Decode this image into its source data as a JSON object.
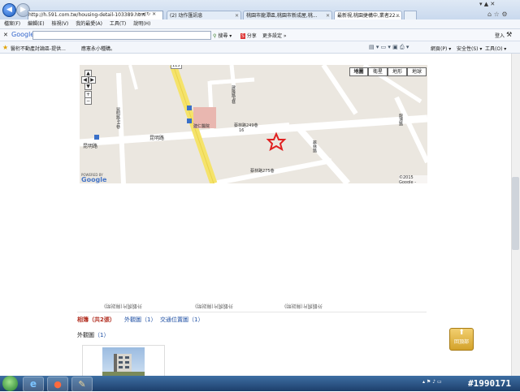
{
  "browser": {
    "address": "http://h.591.com.tw/housing-detail-103389.html",
    "tabs": [
      {
        "label": "(2) 动作匯訊息"
      },
      {
        "label": "桃園市龍潭區,桃園市新成屋,桃..."
      },
      {
        "label": "最新視,桃園捷構中,業者22...",
        "active": true
      }
    ],
    "window_caption": "▾ ▲ ✕"
  },
  "menu": [
    "檔案(F)",
    "編輯(E)",
    "檢視(V)",
    "我的最愛(A)",
    "工具(T)",
    "說明(H)"
  ],
  "google_toolbar": {
    "close": "✕",
    "logo": "Google",
    "search_button": "搜尋",
    "share": "分享",
    "more": "更多設定 »",
    "signin": "登入"
  },
  "favorites": {
    "items": [
      "醫桁不動產討論區-提供...",
      "應憲永小種購。"
    ],
    "right_tools": [
      "網頁(P) ▾",
      "安全性(S) ▾",
      "工具(O) ▾"
    ]
  },
  "map": {
    "types": [
      "地圖",
      "衛星",
      "地形",
      "地球"
    ],
    "selected_type": "地圖",
    "labels": {
      "road1": "昆明路",
      "road2": "昆明路",
      "hospital": "建仁醫院",
      "lane249": "蔡林路249巷",
      "lane275": "蔡林路275巷",
      "lane44": "昆明路44巷",
      "lane4": "建隆路4巷",
      "rd_east": "蔡林路",
      "rd_ne": "龍潭路",
      "num": "115",
      "num16": "16"
    },
    "copyright": "©2015 Google -",
    "powered": "POWERED BY",
    "google": "Google"
  },
  "photo_captions": [
    "外觀照片(無說明)",
    "外觀照片(無說明)",
    "外觀照片(無說明)"
  ],
  "photo_tabs": {
    "album": "相簿（共2張）",
    "exterior": "外觀圖（1）",
    "location": "交通位置圖（1）"
  },
  "exterior_section": {
    "label": "外觀圖",
    "count": "（1）"
  },
  "back_to_top": "回頂部",
  "watermark": "#1990171"
}
